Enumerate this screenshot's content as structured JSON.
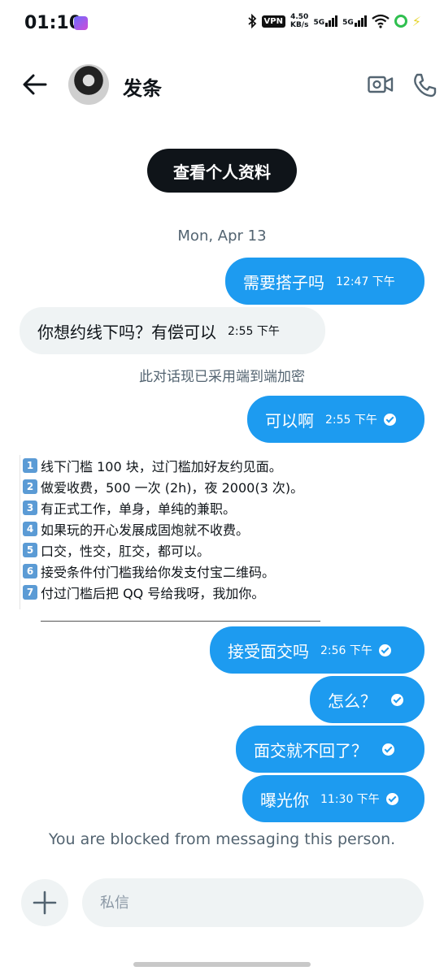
{
  "status_bar": {
    "time": "01:10",
    "vpn": "VPN",
    "speed_value": "4.50",
    "speed_unit": "KB/s",
    "sim1": "5G",
    "sim2": "5G"
  },
  "header": {
    "name": "发条"
  },
  "profile_button": "查看个人资料",
  "date_divider": "Mon, Apr 13",
  "messages": [
    {
      "text": "需要搭子吗",
      "time": "12:47 下午"
    },
    {
      "text": "你想约线下吗？有偿可以",
      "time": "2:55 下午"
    },
    {
      "text": "可以啊",
      "time": "2:55 下午"
    },
    {
      "text": "接受面交吗",
      "time": "2:56 下午"
    },
    {
      "text": "怎么？"
    },
    {
      "text": "面交就不回了？"
    },
    {
      "text": "曝光你",
      "time": "11:30 下午"
    }
  ],
  "encryption_notice": "此对话现已采用端到端加密",
  "rules": [
    {
      "num": "1",
      "text": "线下门槛 100 块，过门槛加好友约见面。"
    },
    {
      "num": "2",
      "text": "做爱收费，500 一次 (2h)，夜 2000(3 次)。"
    },
    {
      "num": "3",
      "text": "有正式工作，单身，单纯的兼职。"
    },
    {
      "num": "4",
      "text": "如果玩的开心发展成固炮就不收费。"
    },
    {
      "num": "5",
      "text": "口交，性交，肛交，都可以。"
    },
    {
      "num": "6",
      "text": "接受条件付门槛我给你发支付宝二维码。"
    },
    {
      "num": "7",
      "text": "付过门槛后把 QQ 号给我呀，我加你。"
    }
  ],
  "blocked_notice": "You are blocked from messaging this person.",
  "composer": {
    "placeholder": "私信"
  },
  "colors": {
    "accent": "#1d9bf0",
    "incoming_bubble": "#eff3f4",
    "button_dark": "#0f1419"
  }
}
